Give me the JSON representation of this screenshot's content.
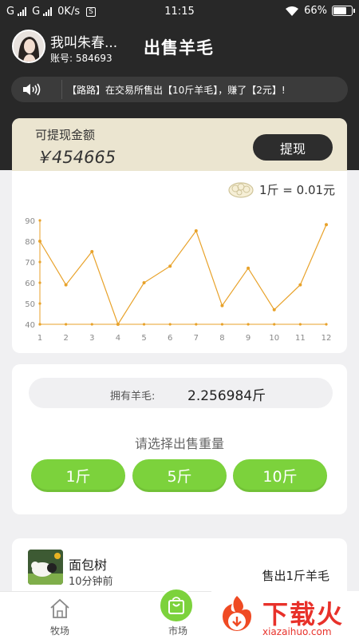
{
  "status_bar": {
    "signal_1": "G",
    "signal_2": "G",
    "speed": "0K/s",
    "sim_badge": "S",
    "time": "11:15",
    "battery": "66%",
    "icons": [
      "signal-icon",
      "wifi-icon",
      "battery-icon"
    ]
  },
  "header": {
    "username": "我叫朱春...",
    "account_label": "账号:",
    "account_id": "584693",
    "title": "出售羊毛"
  },
  "notice": {
    "icon": "speaker-icon",
    "text": "【路路】在交易所售出【10斤羊毛】，赚了【2元】!"
  },
  "balance": {
    "label": "可提现金额",
    "amount": "￥454665",
    "withdraw_label": "提现"
  },
  "price": {
    "icon": "wool-icon",
    "rate": "1斤 = 0.01元"
  },
  "chart_data": {
    "type": "line",
    "title": "",
    "xlabel": "",
    "ylabel": "",
    "x": [
      1,
      2,
      3,
      4,
      5,
      6,
      7,
      8,
      9,
      10,
      11,
      12
    ],
    "values": [
      80,
      59,
      75,
      40,
      60,
      68,
      85,
      49,
      67,
      47,
      59,
      88
    ],
    "y_ticks": [
      40,
      50,
      60,
      70,
      80,
      90
    ],
    "ylim": [
      40,
      90
    ],
    "grid": false,
    "line_color": "#e8a22a"
  },
  "sell": {
    "owned_label": "拥有羊毛:",
    "owned_value": "2.256984斤",
    "choose_label": "请选择出售重量",
    "options": [
      "1斤",
      "5斤",
      "10斤"
    ],
    "accent": "#7cd23c"
  },
  "record": {
    "name": "面包树",
    "time": "10分钟前",
    "action": "售出1斤羊毛"
  },
  "tabs": [
    {
      "label": "牧场",
      "icon": "home-icon"
    },
    {
      "label": "市场",
      "icon": "shopping-bag-icon"
    }
  ],
  "ad": {
    "title": "下载火",
    "url_text": "xiazaihuo.com"
  }
}
